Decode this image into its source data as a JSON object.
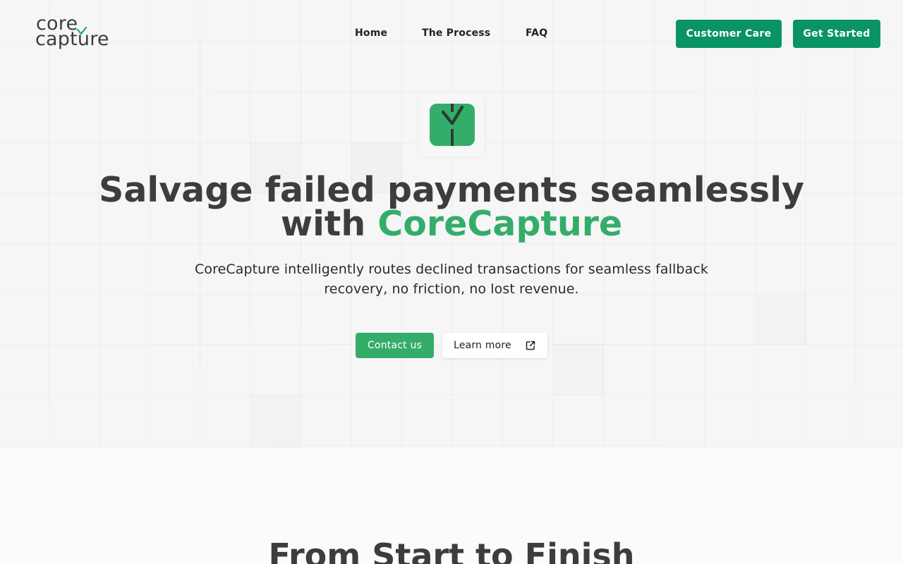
{
  "brand": {
    "logo_line1": "core",
    "logo_line2": "capture",
    "accent_color": "#34ad6a",
    "button_color": "#0a9366"
  },
  "nav": {
    "links": [
      {
        "label": "Home"
      },
      {
        "label": "The Process"
      },
      {
        "label": "FAQ"
      }
    ],
    "customer_care_label": "Customer Care",
    "get_started_label": "Get Started"
  },
  "hero": {
    "icon": "corecapture-app-icon",
    "headline_line1": "Salvage failed payments seamlessly",
    "headline_with": "with ",
    "headline_accent": "CoreCapture",
    "subhead": "CoreCapture intelligently routes declined transactions for seamless fallback recovery, no friction, no lost revenue.",
    "contact_label": "Contact us",
    "learn_more_label": "Learn more",
    "learn_more_icon": "external-link-icon"
  },
  "section": {
    "title": "From Start to Finish"
  }
}
